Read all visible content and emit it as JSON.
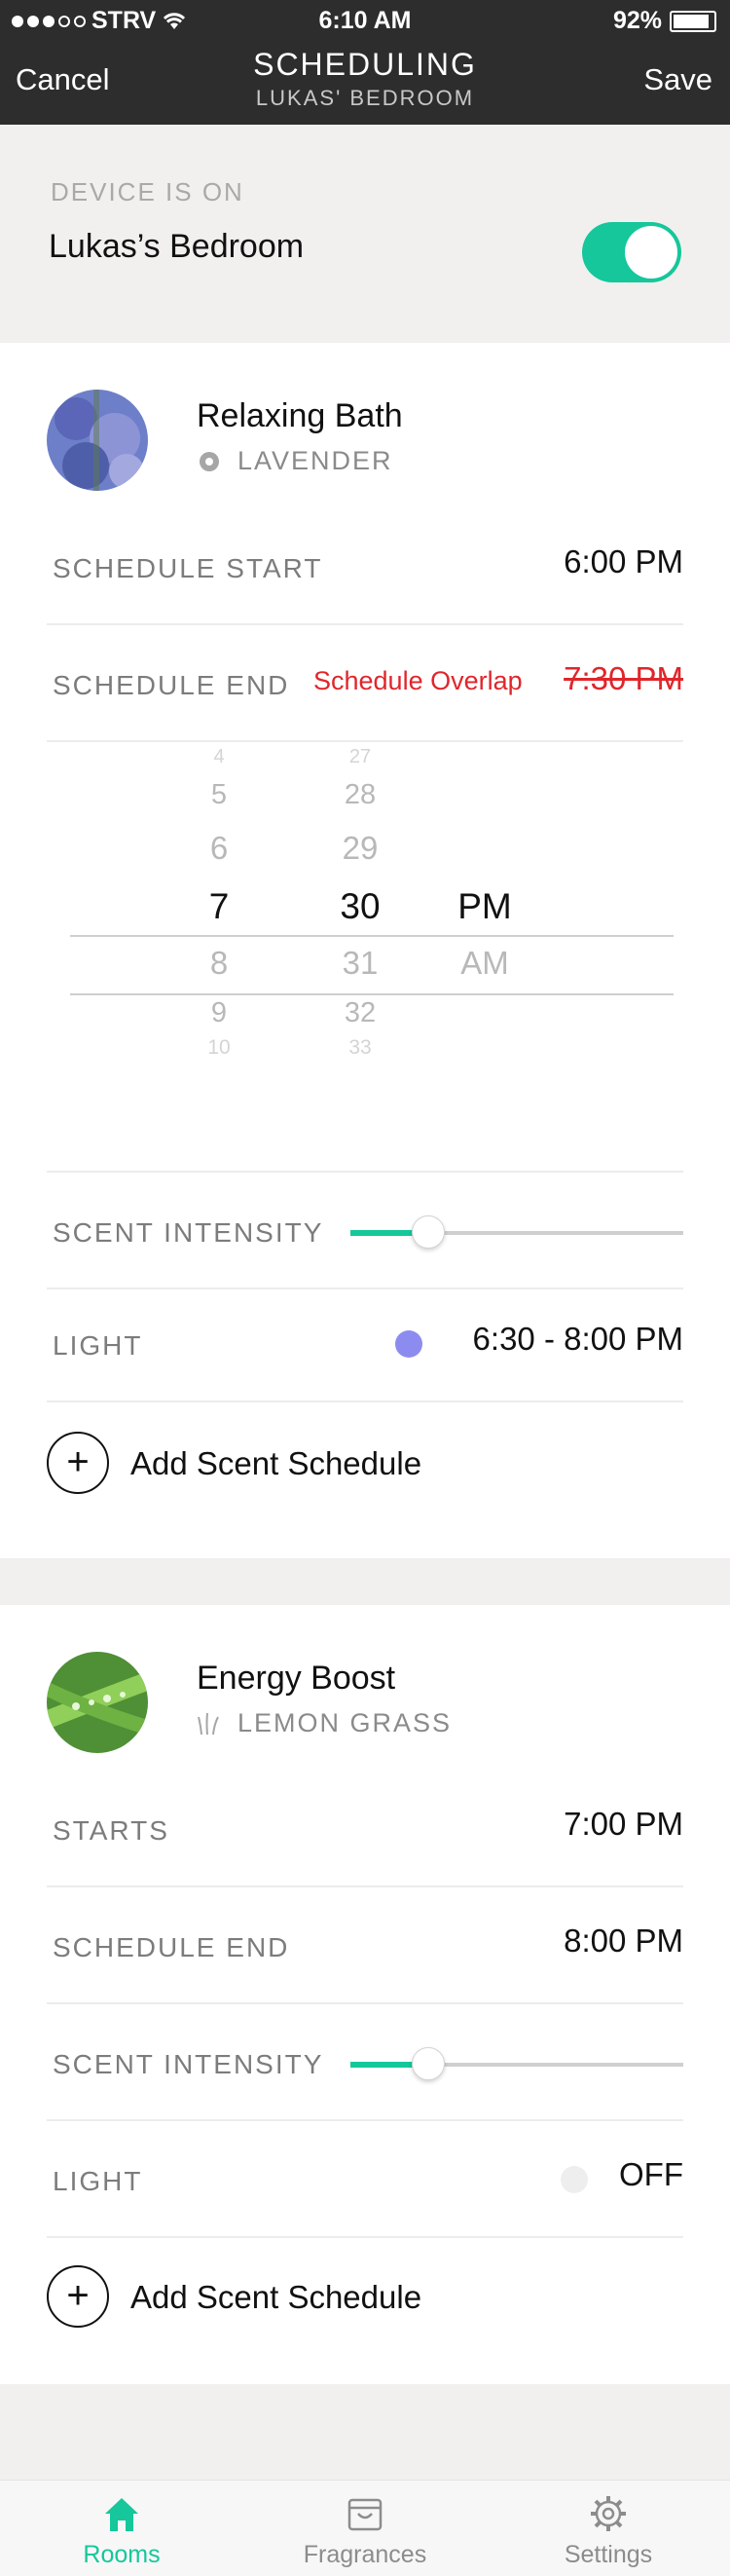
{
  "status_bar": {
    "carrier": "STRV",
    "time": "6:10 AM",
    "battery": "92%"
  },
  "nav": {
    "cancel": "Cancel",
    "title": "SCHEDULING",
    "subtitle": "LUKAS' BEDROOM",
    "save": "Save"
  },
  "device": {
    "status": "DEVICE IS ON",
    "name": "Lukas’s Bedroom",
    "on": true
  },
  "schedules": [
    {
      "title": "Relaxing Bath",
      "fragrance": "LAVENDER",
      "fragrance_icon": "gear-flower-icon",
      "start_label": "SCHEDULE START",
      "start_value": "6:00 PM",
      "end_label": "SCHEDULE END",
      "end_warning": "Schedule Overlap",
      "end_value": "7:30 PM",
      "picker": {
        "hours": [
          "4",
          "5",
          "6",
          "7",
          "8",
          "9",
          "10"
        ],
        "minutes": [
          "27",
          "28",
          "29",
          "30",
          "31",
          "32",
          "33"
        ],
        "periods": [
          "PM",
          "AM"
        ]
      },
      "intensity_label": "SCENT INTENSITY",
      "intensity": 0.23,
      "light_label": "LIGHT",
      "light_value": "6:30 - 8:00 PM",
      "light_color": "#8c8cf0",
      "add_label": "Add Scent Schedule"
    },
    {
      "title": "Energy Boost",
      "fragrance": "LEMON GRASS",
      "fragrance_icon": "grass-icon",
      "start_label": "STARTS",
      "start_value": "7:00 PM",
      "end_label": "SCHEDULE END",
      "end_value": "8:00 PM",
      "intensity_label": "SCENT INTENSITY",
      "intensity": 0.23,
      "light_label": "LIGHT",
      "light_value": "OFF",
      "light_color": "#eeeeee",
      "add_label": "Add Scent Schedule"
    }
  ],
  "tabs": [
    {
      "label": "Rooms",
      "icon": "home-icon",
      "active": true
    },
    {
      "label": "Fragrances",
      "icon": "bag-icon",
      "active": false
    },
    {
      "label": "Settings",
      "icon": "gear-icon",
      "active": false
    }
  ],
  "colors": {
    "accent": "#15c79b",
    "warning": "#e0262b",
    "nav_bg": "#2d2d2d"
  }
}
